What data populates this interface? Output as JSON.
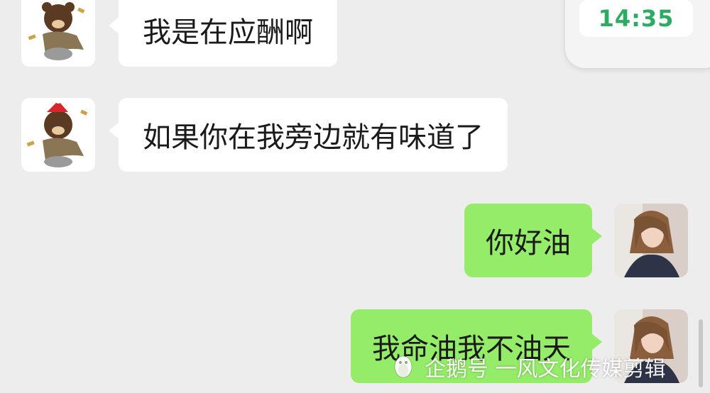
{
  "status": {
    "time": "14:35"
  },
  "messages": [
    {
      "direction": "in",
      "text": "我是在应酬啊"
    },
    {
      "direction": "in",
      "text": "如果你在我旁边就有味道了"
    },
    {
      "direction": "out",
      "text": "你好油"
    },
    {
      "direction": "out",
      "text": "我命油我不油天"
    }
  ],
  "avatars": {
    "incoming": "bear-sticker-avatar",
    "outgoing": "girl-photo-avatar"
  },
  "watermark": {
    "text": "企鹅号 一风文化传媒剪辑"
  },
  "colors": {
    "background": "#ededed",
    "incoming_bubble": "#ffffff",
    "outgoing_bubble": "#95ec69",
    "time_text": "#2dab63"
  }
}
